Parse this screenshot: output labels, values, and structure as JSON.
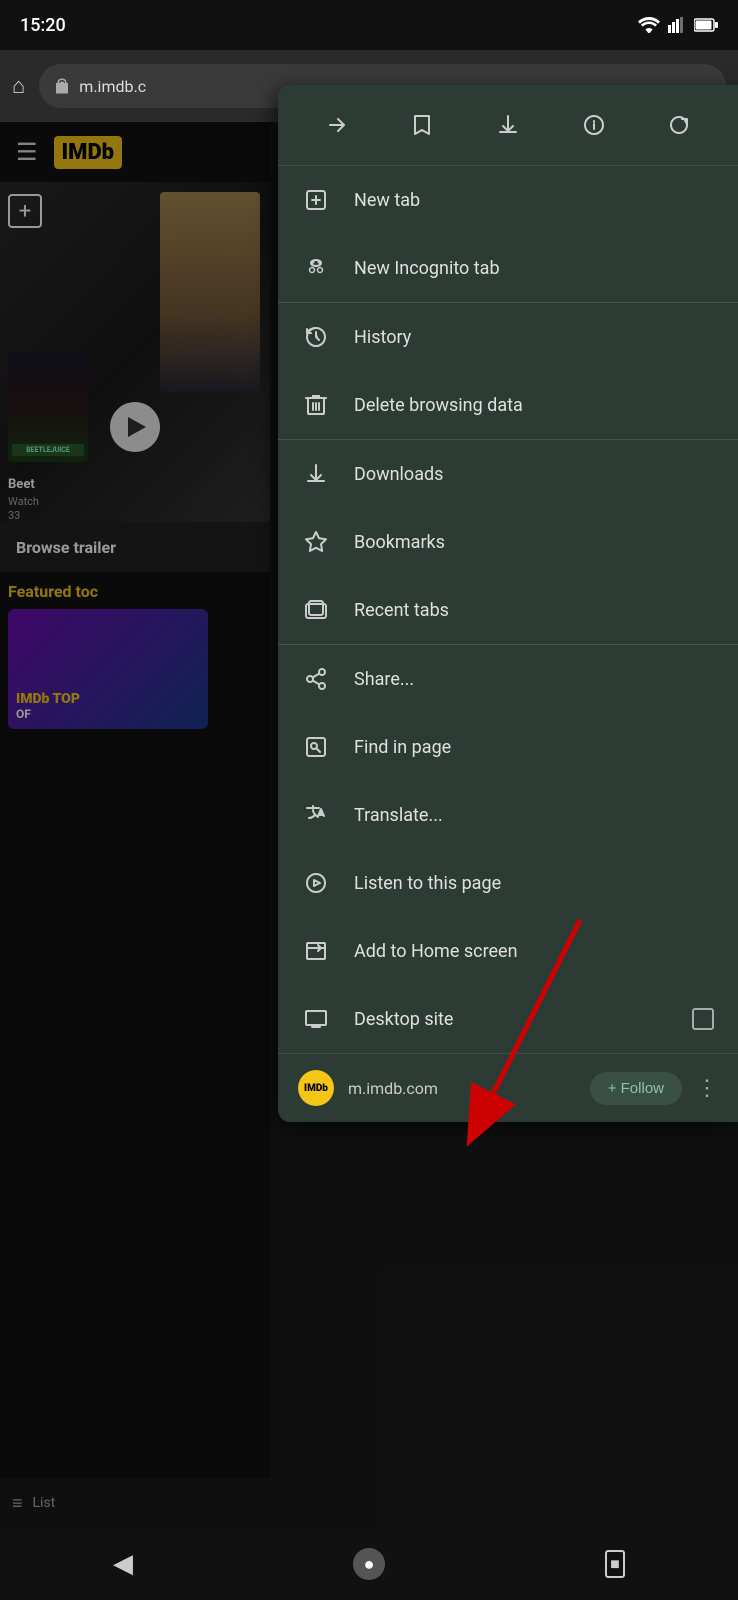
{
  "statusBar": {
    "time": "15:20"
  },
  "browserBar": {
    "url": "m.imdb.c"
  },
  "page": {
    "imdbLogo": "IMDb",
    "browseTrailers": "Browse trailer",
    "featuredToday": "Featured toc",
    "listLabel": "List",
    "movieTitle": "Beet",
    "movieSub": "Watch",
    "movieLikes": "33"
  },
  "contextMenu": {
    "toolbar": {
      "forwardLabel": "→",
      "bookmarkLabel": "☆",
      "downloadLabel": "⬇",
      "infoLabel": "ℹ",
      "refreshLabel": "↺"
    },
    "items": [
      {
        "id": "new-tab",
        "label": "New tab",
        "icon": "new-tab-icon"
      },
      {
        "id": "new-incognito-tab",
        "label": "New Incognito tab",
        "icon": "incognito-icon"
      },
      {
        "id": "history",
        "label": "History",
        "icon": "history-icon"
      },
      {
        "id": "delete-browsing-data",
        "label": "Delete browsing data",
        "icon": "delete-icon"
      },
      {
        "id": "downloads",
        "label": "Downloads",
        "icon": "downloads-icon"
      },
      {
        "id": "bookmarks",
        "label": "Bookmarks",
        "icon": "bookmarks-icon"
      },
      {
        "id": "recent-tabs",
        "label": "Recent tabs",
        "icon": "recent-tabs-icon"
      },
      {
        "id": "share",
        "label": "Share...",
        "icon": "share-icon"
      },
      {
        "id": "find-in-page",
        "label": "Find in page",
        "icon": "find-icon"
      },
      {
        "id": "translate",
        "label": "Translate...",
        "icon": "translate-icon"
      },
      {
        "id": "listen-to-page",
        "label": "Listen to this page",
        "icon": "listen-icon"
      },
      {
        "id": "add-to-home",
        "label": "Add to Home screen",
        "icon": "add-home-icon"
      },
      {
        "id": "desktop-site",
        "label": "Desktop site",
        "icon": "desktop-icon",
        "hasCheckbox": true
      }
    ],
    "followBar": {
      "siteIconText": "IMDb",
      "url": "m.imdb.com",
      "followButtonLabel": "+ Follow"
    }
  },
  "navBar": {
    "backLabel": "◀",
    "homeLabel": "●",
    "recentLabel": "■"
  }
}
